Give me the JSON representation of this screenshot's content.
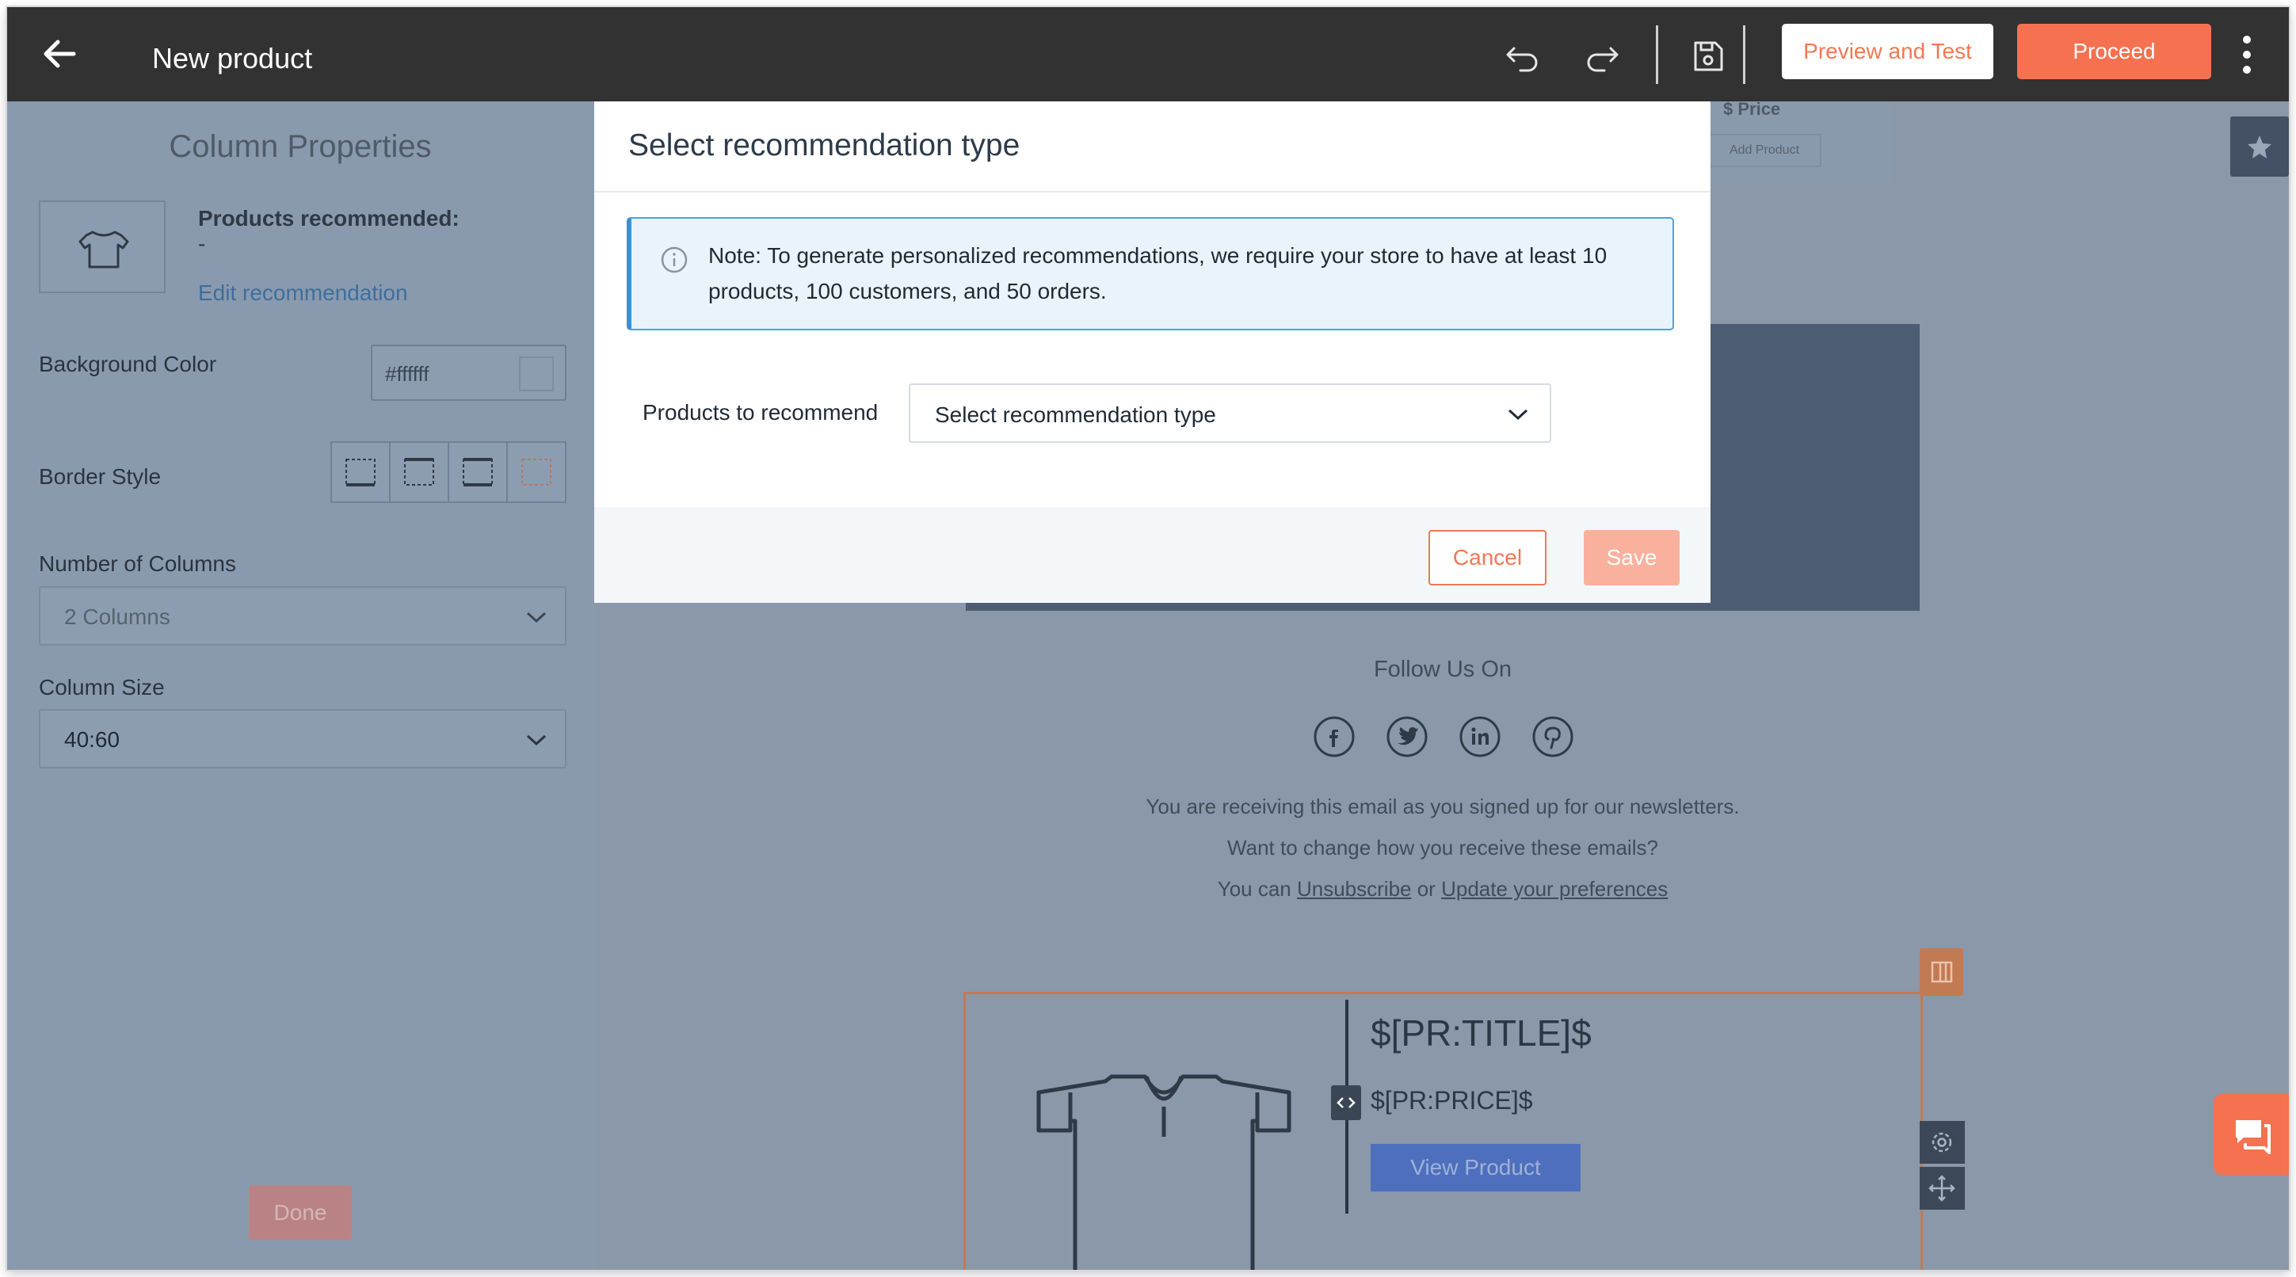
{
  "header": {
    "title": "New product",
    "preview_label": "Preview and Test",
    "proceed_label": "Proceed",
    "icons": [
      "back-arrow-icon",
      "undo-icon",
      "redo-icon",
      "save-icon",
      "more-vertical-icon"
    ]
  },
  "left_panel": {
    "title": "Column Properties",
    "products_recommended_label": "Products recommended:",
    "products_recommended_value": "-",
    "edit_link": "Edit recommendation",
    "background_color_label": "Background Color",
    "background_color_value": "#ffffff",
    "border_style_label": "Border Style",
    "columns_label": "Number of Columns",
    "columns_value": "2 Columns",
    "column_size_label": "Column Size",
    "column_size_value": "40:60",
    "done_label": "Done"
  },
  "canvas": {
    "price_label": "$ Price",
    "add_product_label": "Add Product",
    "follow_title": "Follow Us On",
    "social_icons": [
      "facebook-icon",
      "twitter-icon",
      "linkedin-icon",
      "pinterest-icon"
    ],
    "footer_line1": "You are receiving this email as you signed up for our newsletters.",
    "footer_line2": "Want to change how you receive these emails?",
    "footer_line3_prefix": "You can ",
    "footer_unsubscribe": "Unsubscribe",
    "footer_or": " or ",
    "footer_preferences": "Update your preferences",
    "product_title": "$[PR:TITLE]$",
    "product_price": "$[PR:PRICE]$",
    "view_product_label": "View Product"
  },
  "modal": {
    "title": "Select recommendation type",
    "note": "Note: To generate personalized recommendations, we require your store to have at least 10 products, 100 customers, and 50 orders.",
    "field_label": "Products to recommend",
    "select_value": "Select recommendation type",
    "cancel_label": "Cancel",
    "save_label": "Save"
  },
  "colors": {
    "accent": "#f6714f",
    "topbar": "#323232",
    "info_border": "#4aa3dc",
    "info_bg": "#e8f3fc"
  }
}
